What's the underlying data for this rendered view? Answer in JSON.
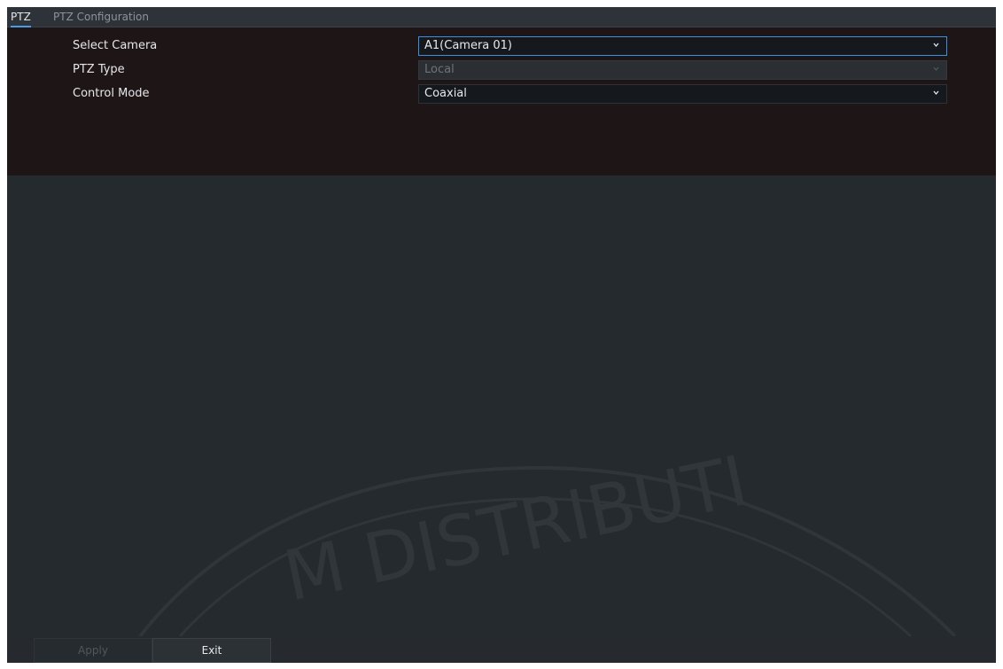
{
  "tabs": [
    {
      "label": "PTZ",
      "active": true
    },
    {
      "label": "PTZ Configuration",
      "active": false
    }
  ],
  "form": {
    "select_camera": {
      "label": "Select Camera",
      "value": "A1(Camera 01)"
    },
    "ptz_type": {
      "label": "PTZ Type",
      "value": "Local"
    },
    "control_mode": {
      "label": "Control Mode",
      "value": "Coaxial"
    }
  },
  "buttons": {
    "apply_label": "Apply",
    "exit_label": "Exit"
  },
  "colors": {
    "accent": "#4a9ce8",
    "panel_bg": "#1e1517",
    "content_bg": "#242a2e"
  }
}
